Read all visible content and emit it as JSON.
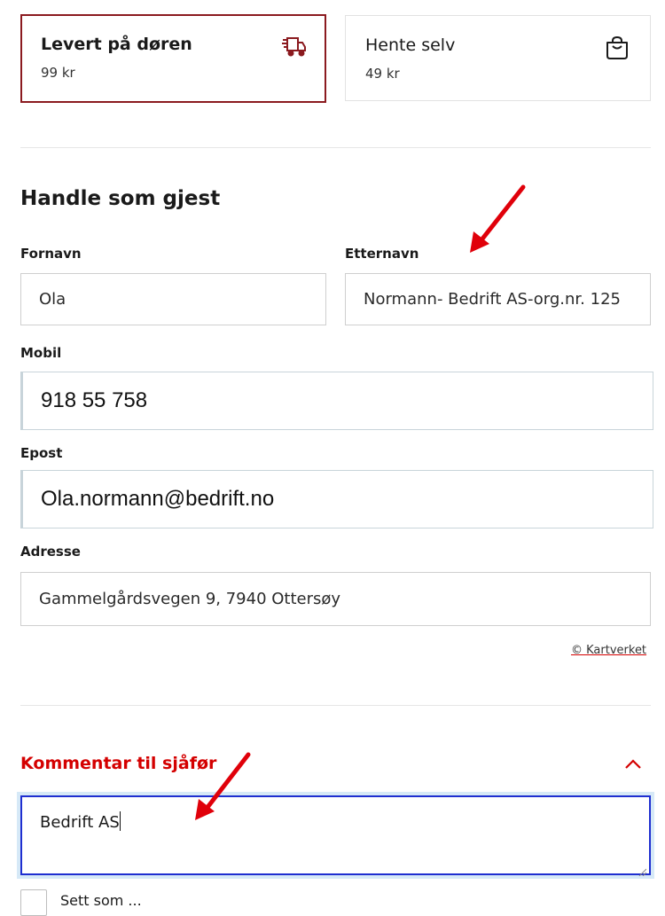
{
  "delivery": {
    "options": [
      {
        "title": "Levert på døren",
        "price": "99 kr",
        "icon": "delivery-truck-icon",
        "selected": true
      },
      {
        "title": "Hente selv",
        "price": "49 kr",
        "icon": "shopping-bag-icon",
        "selected": false
      }
    ]
  },
  "guest": {
    "heading": "Handle som gjest",
    "first_name": {
      "label": "Fornavn",
      "value": "Ola"
    },
    "last_name": {
      "label": "Etternavn",
      "value": "Normann- Bedrift AS-org.nr. 125"
    },
    "mobile": {
      "label": "Mobil",
      "value": "918 55 758"
    },
    "email": {
      "label": "Epost",
      "value": "Ola.normann@bedrift.no"
    },
    "address": {
      "label": "Adresse",
      "value": "Gammelgårdsvegen 9, 7940 Ottersøy"
    },
    "map_credit": "© Kartverket"
  },
  "comment": {
    "toggle_label": "Kommentar til sjåfør",
    "expanded": true,
    "value": "Bedrift AS"
  },
  "checkbox": {
    "label": "Sett som ..."
  },
  "colors": {
    "brand": "#8b1a1f",
    "accent_red": "#d40000",
    "focus_blue": "#1f2fd0",
    "annotation_red": "#e0000a"
  }
}
